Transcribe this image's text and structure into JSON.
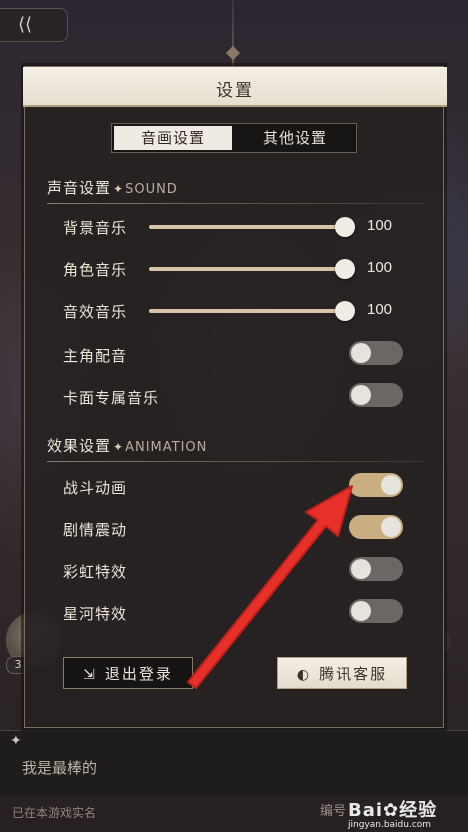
{
  "dialog": {
    "title": "设置",
    "tabs": [
      {
        "label": "音画设置",
        "active": true
      },
      {
        "label": "其他设置",
        "active": false
      }
    ],
    "sound_section": {
      "title_cn": "声音设置",
      "title_en": "SOUND",
      "sliders": [
        {
          "label": "背景音乐",
          "value": "100"
        },
        {
          "label": "角色音乐",
          "value": "100"
        },
        {
          "label": "音效音乐",
          "value": "100"
        }
      ],
      "toggles": [
        {
          "label": "主角配音",
          "on": false
        },
        {
          "label": "卡面专属音乐",
          "on": false
        }
      ]
    },
    "animation_section": {
      "title_cn": "效果设置",
      "title_en": "ANIMATION",
      "toggles": [
        {
          "label": "战斗动画",
          "on": true
        },
        {
          "label": "剧情震动",
          "on": true
        },
        {
          "label": "彩虹特效",
          "on": false
        },
        {
          "label": "星河特效",
          "on": false
        }
      ]
    },
    "footer": {
      "logout_label": "退出登录",
      "support_label": "腾讯客服"
    }
  },
  "background": {
    "level": "3",
    "signature": "我是最棒的",
    "bottom_note": "已在本游戏实名",
    "bottom_right": "编号",
    "watermark_main": "Bai✿经验",
    "watermark_sub": "jingyan.baidu.com"
  },
  "colors": {
    "accent_gold": "#c9ae82",
    "toggle_off": "#6b6764",
    "annotation_red": "#e8302a"
  }
}
